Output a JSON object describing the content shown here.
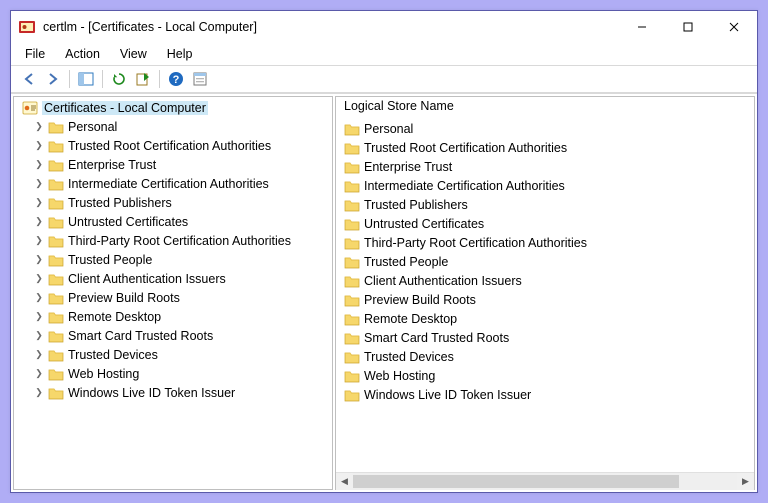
{
  "window": {
    "title": "certlm - [Certificates - Local Computer]"
  },
  "menu": {
    "file": "File",
    "action": "Action",
    "view": "View",
    "help": "Help"
  },
  "tree": {
    "root": "Certificates - Local Computer",
    "items": [
      "Personal",
      "Trusted Root Certification Authorities",
      "Enterprise Trust",
      "Intermediate Certification Authorities",
      "Trusted Publishers",
      "Untrusted Certificates",
      "Third-Party Root Certification Authorities",
      "Trusted People",
      "Client Authentication Issuers",
      "Preview Build Roots",
      "Remote Desktop",
      "Smart Card Trusted Roots",
      "Trusted Devices",
      "Web Hosting",
      "Windows Live ID Token Issuer"
    ]
  },
  "list": {
    "column_header": "Logical Store Name",
    "items": [
      "Personal",
      "Trusted Root Certification Authorities",
      "Enterprise Trust",
      "Intermediate Certification Authorities",
      "Trusted Publishers",
      "Untrusted Certificates",
      "Third-Party Root Certification Authorities",
      "Trusted People",
      "Client Authentication Issuers",
      "Preview Build Roots",
      "Remote Desktop",
      "Smart Card Trusted Roots",
      "Trusted Devices",
      "Web Hosting",
      "Windows Live ID Token Issuer"
    ]
  }
}
